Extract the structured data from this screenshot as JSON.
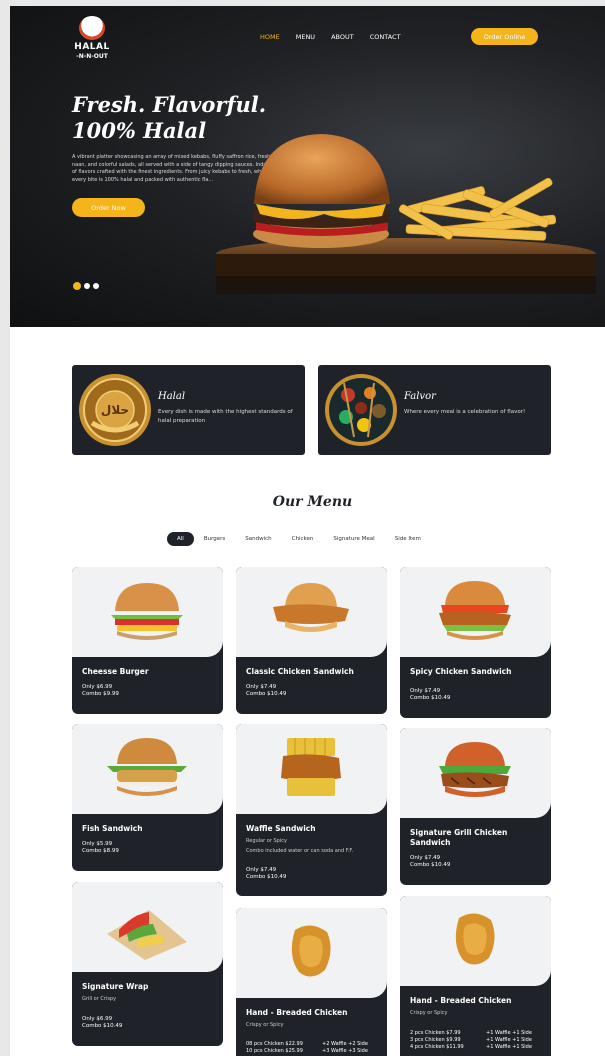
{
  "brand": {
    "line1": "HALAL",
    "line2": "-N-N-OUT"
  },
  "nav": {
    "items": [
      "HOME",
      "MENU",
      "ABOUT",
      "CONTACT"
    ],
    "active_index": 0,
    "order_online": "Order Online"
  },
  "hero": {
    "title": "Fresh. Flavorful. 100% Halal",
    "description": "A vibrant platter showcasing an array of mixed kebabs, fluffy saffron rice, freshly baked naan, and colorful salads, all served with a side of tangy dipping sauces. Indulge in a feast of flavors crafted with the finest ingredients. From juicy kebabs to fresh, wholesome sides, every bite is 100% halal and packed with authentic fla...",
    "cta": "Order Now",
    "slides": 3,
    "active_slide": 0
  },
  "features": [
    {
      "title": "Halal",
      "desc": "Every dish is made with the highest standards of halal preparation",
      "icon": "halal-guarantee-badge-icon"
    },
    {
      "title": "Falvor",
      "desc": "Where every meal is a celebration of flavor!",
      "icon": "spices-bowl-icon"
    }
  ],
  "menu": {
    "title": "Our Menu",
    "tabs": [
      "All",
      "Burgers",
      "Sandwich",
      "Chicken",
      "Signature Meal",
      "Side Item"
    ],
    "active_tab": 0
  },
  "cards": [
    {
      "name": "Cheesse Burger",
      "sub": "",
      "prices": [
        "Only $6.99",
        "Combo $9.99"
      ],
      "icon": "cheeseburger-icon"
    },
    {
      "name": "Classic Chicken Sandwich",
      "sub": "",
      "prices": [
        "Only $7.49",
        "Combo $10.49"
      ],
      "icon": "chicken-sandwich-icon"
    },
    {
      "name": "Spicy Chicken Sandwich",
      "sub": "",
      "prices": [
        "Only $7.49",
        "Combo $10.49"
      ],
      "icon": "spicy-chicken-sandwich-icon"
    },
    {
      "name": "Fish Sandwich",
      "sub": "",
      "prices": [
        "Only $5.99",
        "Combo $8.99"
      ],
      "icon": "fish-sandwich-icon"
    },
    {
      "name": "Waffle Sandwich",
      "sub": "Regular or Spicy",
      "sub2": "Combo included water or can soda and F.F.",
      "prices": [
        "Only $7.49",
        "Combo $10.49"
      ],
      "icon": "waffle-sandwich-icon"
    },
    {
      "name": "Signature Grill Chicken Sandwich",
      "sub": "",
      "prices": [
        "Only $7.49",
        "Combo $10.49"
      ],
      "icon": "grill-chicken-sandwich-icon"
    },
    {
      "name": "Signature Wrap",
      "sub": "Grill or Crispy",
      "prices": [
        "Only $6.99",
        "Combo $10.49"
      ],
      "icon": "wrap-icon"
    },
    {
      "name": "Hand - Breaded Chicken",
      "sub": "Crispy or Spicy",
      "price_rows": [
        [
          "08 pcs Chicken $22.99",
          "+2 Waffle +2 Side"
        ],
        [
          "10 pcs Chicken $25.99",
          "+3 Waffle +3 Side"
        ]
      ],
      "icon": "fried-chicken-icon"
    },
    {
      "name": "Hand - Breaded Chicken",
      "sub": "Crispy or Spicy",
      "price_rows": [
        [
          "2 pcs Chicken $7.99",
          "+1 Waffle +1 Side"
        ],
        [
          "3 pcs Chicken $9.99",
          "+1 Waffle +1 Side"
        ],
        [
          "4 pcs Chicken $11.99",
          "+1 Waffle +1 Side"
        ]
      ],
      "icon": "fried-chicken-icon"
    }
  ],
  "colors": {
    "accent": "#f4b41a",
    "dark": "#1f2329",
    "light_bg": "#f1f2f4"
  }
}
